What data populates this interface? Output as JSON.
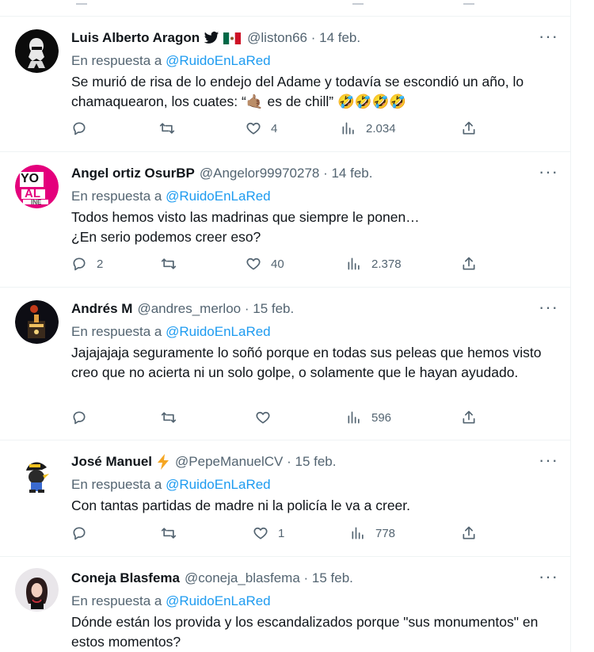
{
  "reply_prefix": "En respuesta a ",
  "colors": {
    "link": "#1d9bf0",
    "muted": "#536471",
    "text": "#0f1419"
  },
  "tweets": [
    {
      "name": "Luis Alberto Aragon",
      "handle": "@liston66",
      "date": "14 feb.",
      "reply_to": "@RuidoEnLaRed",
      "text": "Se murió de risa de lo endejo del Adame y todavía se escondió un año, lo chamaquearon, los cuates: “🤙🏽 es de chill” 🤣🤣🤣🤣",
      "badges": [
        "bird-icon",
        "mexico-flag-icon"
      ],
      "stats": {
        "replies": "",
        "retweets": "",
        "likes": "4",
        "views": "2.034"
      }
    },
    {
      "name": "Angel ortiz OsurBP",
      "handle": "@Angelor99970278",
      "date": "14 feb.",
      "reply_to": "@RuidoEnLaRed",
      "text": "Todos hemos visto las madrinas que siempre le ponen…\n¿En serio podemos creer eso?",
      "avatar_text": [
        "YO",
        "AL",
        "INE"
      ],
      "stats": {
        "replies": "2",
        "retweets": "",
        "likes": "40",
        "views": "2.378"
      }
    },
    {
      "name": "Andrés M",
      "handle": "@andres_merloo",
      "date": "15 feb.",
      "reply_to": "@RuidoEnLaRed",
      "text": "Jajajajaja seguramente lo soñó porque en todas sus peleas que hemos visto creo que no acierta ni un solo golpe, o solamente que le hayan ayudado.",
      "stats": {
        "replies": "",
        "retweets": "",
        "likes": "",
        "views": "596"
      }
    },
    {
      "name": "José Manuel",
      "handle": "@PepeManuelCV",
      "date": "15 feb.",
      "reply_to": "@RuidoEnLaRed",
      "text": "Con tantas partidas de madre ni la policía le va a creer.",
      "badges": [
        "lightning-icon"
      ],
      "stats": {
        "replies": "",
        "retweets": "",
        "likes": "1",
        "views": "778"
      }
    },
    {
      "name": "Coneja Blasfema",
      "handle": "@coneja_blasfema",
      "date": "15 feb.",
      "reply_to": "@RuidoEnLaRed",
      "text": "Dónde están los provida y los escandalizados porque \"sus monumentos\" en estos momentos?",
      "stats": {
        "replies": "",
        "retweets": "",
        "likes": "",
        "views": ""
      }
    }
  ]
}
